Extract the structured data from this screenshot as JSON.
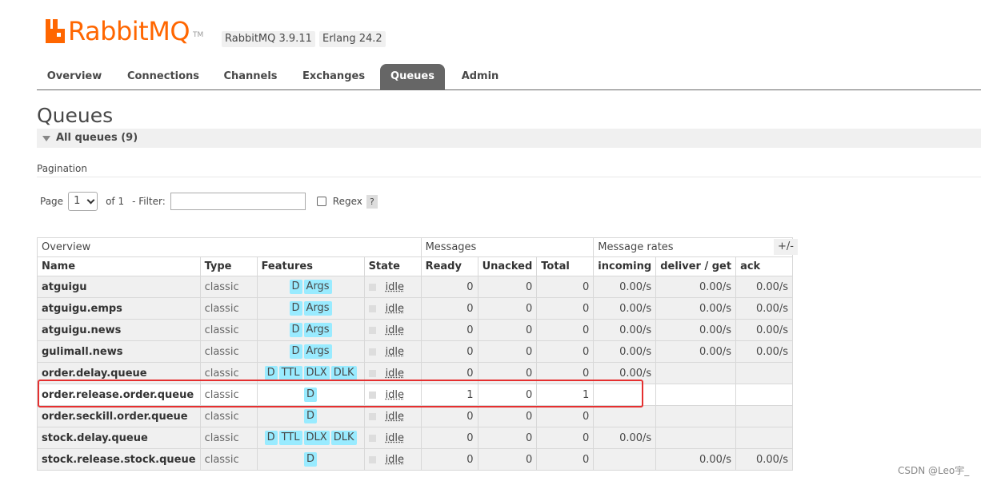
{
  "header": {
    "logo_text": "RabbitMQ",
    "logo_tm": "TM",
    "version": "RabbitMQ 3.9.11",
    "erlang": "Erlang 24.2"
  },
  "nav": {
    "tabs": [
      "Overview",
      "Connections",
      "Channels",
      "Exchanges",
      "Queues",
      "Admin"
    ],
    "active": "Queues"
  },
  "page": {
    "title": "Queues",
    "section": "All queues (9)",
    "pagination_label": "Pagination",
    "page_label": "Page",
    "page_value": "1",
    "of_label": "of 1",
    "filter_label": "- Filter:",
    "filter_value": "",
    "regex_label": "Regex",
    "help": "?",
    "plusminus": "+/-"
  },
  "table": {
    "groups": [
      "Overview",
      "Messages",
      "Message rates"
    ],
    "columns": [
      "Name",
      "Type",
      "Features",
      "State",
      "Ready",
      "Unacked",
      "Total",
      "incoming",
      "deliver / get",
      "ack"
    ],
    "rows": [
      {
        "name": "atguigu",
        "type": "classic",
        "features": [
          "D",
          "Args"
        ],
        "state": "idle",
        "ready": "0",
        "unacked": "0",
        "total": "0",
        "incoming": "0.00/s",
        "deliver": "0.00/s",
        "ack": "0.00/s"
      },
      {
        "name": "atguigu.emps",
        "type": "classic",
        "features": [
          "D",
          "Args"
        ],
        "state": "idle",
        "ready": "0",
        "unacked": "0",
        "total": "0",
        "incoming": "0.00/s",
        "deliver": "0.00/s",
        "ack": "0.00/s"
      },
      {
        "name": "atguigu.news",
        "type": "classic",
        "features": [
          "D",
          "Args"
        ],
        "state": "idle",
        "ready": "0",
        "unacked": "0",
        "total": "0",
        "incoming": "0.00/s",
        "deliver": "0.00/s",
        "ack": "0.00/s"
      },
      {
        "name": "gulimall.news",
        "type": "classic",
        "features": [
          "D",
          "Args"
        ],
        "state": "idle",
        "ready": "0",
        "unacked": "0",
        "total": "0",
        "incoming": "0.00/s",
        "deliver": "0.00/s",
        "ack": "0.00/s"
      },
      {
        "name": "order.delay.queue",
        "type": "classic",
        "features": [
          "D",
          "TTL",
          "DLX",
          "DLK"
        ],
        "state": "idle",
        "ready": "0",
        "unacked": "0",
        "total": "0",
        "incoming": "0.00/s",
        "deliver": "",
        "ack": ""
      },
      {
        "name": "order.release.order.queue",
        "type": "classic",
        "features": [
          "D"
        ],
        "state": "idle",
        "ready": "1",
        "unacked": "0",
        "total": "1",
        "incoming": "",
        "deliver": "",
        "ack": ""
      },
      {
        "name": "order.seckill.order.queue",
        "type": "classic",
        "features": [
          "D"
        ],
        "state": "idle",
        "ready": "0",
        "unacked": "0",
        "total": "0",
        "incoming": "",
        "deliver": "",
        "ack": ""
      },
      {
        "name": "stock.delay.queue",
        "type": "classic",
        "features": [
          "D",
          "TTL",
          "DLX",
          "DLK"
        ],
        "state": "idle",
        "ready": "0",
        "unacked": "0",
        "total": "0",
        "incoming": "0.00/s",
        "deliver": "",
        "ack": ""
      },
      {
        "name": "stock.release.stock.queue",
        "type": "classic",
        "features": [
          "D"
        ],
        "state": "idle",
        "ready": "0",
        "unacked": "0",
        "total": "0",
        "incoming": "",
        "deliver": "0.00/s",
        "ack": "0.00/s"
      }
    ]
  },
  "watermark": "CSDN @Leo宇_",
  "colors": {
    "brand": "#ff6600",
    "tab_active": "#666666",
    "badge": "#99ebff",
    "highlight": "#e53030"
  }
}
